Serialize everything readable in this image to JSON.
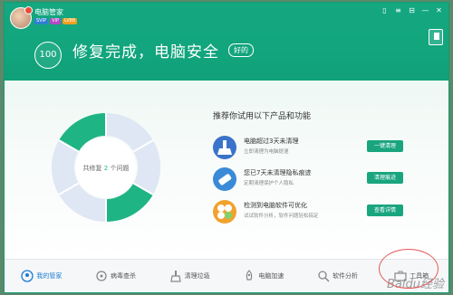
{
  "header": {
    "app_title": "电脑管家",
    "tags": [
      "SVIP",
      "VIP",
      "LV88"
    ],
    "window_controls": [
      "▯",
      "≡",
      "⊟",
      "—",
      "✕"
    ],
    "score": "100",
    "status_title": "修复完成，电脑安全",
    "status_badge": "好的"
  },
  "summary": {
    "label": "共修复",
    "count": "2",
    "unit": "个问题"
  },
  "donut_colors": {
    "active": "#1fb484",
    "inactive": "#dfe6f4"
  },
  "recommendations": {
    "title": "推荐你试用以下产品和功能",
    "items": [
      {
        "title": "电脑超过3天未清理",
        "subtitle": "立即清理为电脑提速",
        "button": "一键清理",
        "icon": "broom-icon",
        "color": "#3a73c9"
      },
      {
        "title": "您已7天未清理隐私痕迹",
        "subtitle": "定期清理保护个人隐私",
        "button": "清理痕迹",
        "icon": "eraser-icon",
        "color": "#3a8ad8"
      },
      {
        "title": "检测到电脑软件可优化",
        "subtitle": "试试软件分析，软件问题轻松搞定",
        "button": "查看详情",
        "icon": "puzzle-icon",
        "color": "#f1a22e"
      }
    ]
  },
  "nav": [
    {
      "label": "我的管家",
      "icon": "home-icon",
      "active": true
    },
    {
      "label": "病毒查杀",
      "icon": "virus-icon",
      "active": false
    },
    {
      "label": "清理垃圾",
      "icon": "broom-icon",
      "active": false
    },
    {
      "label": "电脑加速",
      "icon": "rocket-icon",
      "active": false
    },
    {
      "label": "软件分析",
      "icon": "analysis-icon",
      "active": false
    },
    {
      "label": "工具箱",
      "icon": "toolbox-icon",
      "active": false
    }
  ],
  "watermark": "Baidu经验"
}
